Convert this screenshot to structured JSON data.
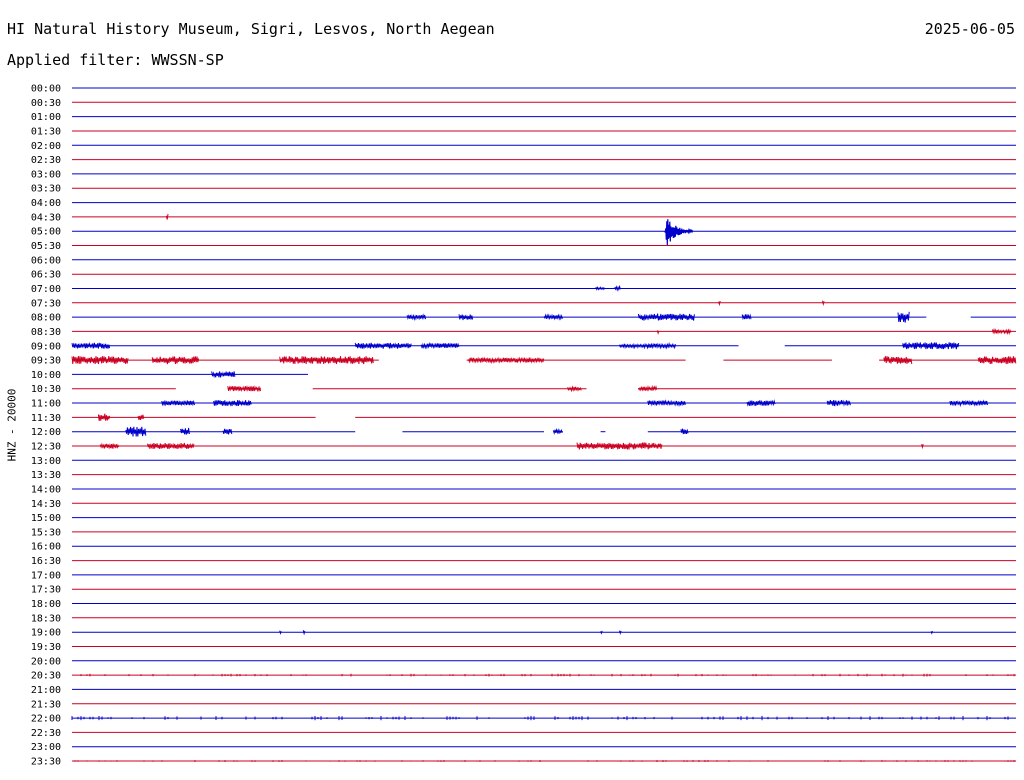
{
  "header": {
    "station": "HI Natural History Museum, Sigri, Lesvos, North Aegean",
    "date": "2025-06-05",
    "filter": "Applied filter: WWSSN-SP"
  },
  "chart_data": {
    "type": "line",
    "title": "HI Natural History Museum, Sigri, Lesvos, North Aegean",
    "subtitle": "Applied filter: WWSSN-SP",
    "ylabel": "HNZ - 20000",
    "xlabel": "",
    "colors": {
      "even_trace": "#0000cc",
      "odd_trace": "#cc0022"
    },
    "traces": [
      {
        "label": "00:00",
        "bursts": []
      },
      {
        "label": "00:30",
        "bursts": []
      },
      {
        "label": "01:00",
        "bursts": []
      },
      {
        "label": "01:30",
        "bursts": []
      },
      {
        "label": "02:00",
        "bursts": []
      },
      {
        "label": "02:30",
        "bursts": []
      },
      {
        "label": "03:00",
        "bursts": []
      },
      {
        "label": "03:30",
        "bursts": []
      },
      {
        "label": "04:00",
        "bursts": []
      },
      {
        "label": "04:30",
        "bursts": [
          {
            "t": 0.1,
            "w": 0.002,
            "a": 0.3
          }
        ]
      },
      {
        "label": "05:00",
        "bursts": [
          {
            "t": 0.628,
            "w": 0.03,
            "a": 1.0,
            "event": true
          }
        ]
      },
      {
        "label": "05:30",
        "bursts": []
      },
      {
        "label": "06:00",
        "bursts": []
      },
      {
        "label": "06:30",
        "bursts": []
      },
      {
        "label": "07:00",
        "bursts": [
          {
            "t": 0.555,
            "w": 0.01,
            "a": 0.15
          },
          {
            "t": 0.575,
            "w": 0.006,
            "a": 0.2
          }
        ]
      },
      {
        "label": "07:30",
        "bursts": [
          {
            "t": 0.685,
            "w": 0.002,
            "a": 0.2
          },
          {
            "t": 0.795,
            "w": 0.002,
            "a": 0.2
          }
        ]
      },
      {
        "label": "08:00",
        "bursts": [
          {
            "t": 0.355,
            "w": 0.02,
            "a": 0.25
          },
          {
            "t": 0.41,
            "w": 0.015,
            "a": 0.3
          },
          {
            "t": 0.5,
            "w": 0.02,
            "a": 0.2
          },
          {
            "t": 0.6,
            "w": 0.06,
            "a": 0.35
          },
          {
            "t": 0.71,
            "w": 0.01,
            "a": 0.3
          },
          {
            "t": 0.875,
            "w": 0.012,
            "a": 0.6
          }
        ],
        "gaps": [
          [
            0.905,
            0.952
          ]
        ]
      },
      {
        "label": "08:30",
        "bursts": [
          {
            "t": 0.62,
            "w": 0.002,
            "a": 0.2
          },
          {
            "t": 0.975,
            "w": 0.02,
            "a": 0.2
          }
        ]
      },
      {
        "label": "09:00",
        "bursts": [
          {
            "t": 0.0,
            "w": 0.04,
            "a": 0.3
          },
          {
            "t": 0.3,
            "w": 0.06,
            "a": 0.3
          },
          {
            "t": 0.37,
            "w": 0.04,
            "a": 0.25
          },
          {
            "t": 0.58,
            "w": 0.06,
            "a": 0.2
          },
          {
            "t": 0.88,
            "w": 0.06,
            "a": 0.35
          }
        ],
        "gaps": [
          [
            0.706,
            0.755
          ]
        ]
      },
      {
        "label": "09:30",
        "bursts": [
          {
            "t": 0.0,
            "w": 0.06,
            "a": 0.4
          },
          {
            "t": 0.085,
            "w": 0.05,
            "a": 0.4
          },
          {
            "t": 0.22,
            "w": 0.1,
            "a": 0.4
          },
          {
            "t": 0.42,
            "w": 0.08,
            "a": 0.25
          },
          {
            "t": 0.86,
            "w": 0.03,
            "a": 0.4
          },
          {
            "t": 0.96,
            "w": 0.04,
            "a": 0.4
          }
        ],
        "gaps": [
          [
            0.325,
            0.418
          ],
          [
            0.65,
            0.69
          ],
          [
            0.805,
            0.855
          ]
        ]
      },
      {
        "label": "10:00",
        "bursts": [
          {
            "t": 0.148,
            "w": 0.025,
            "a": 0.3
          }
        ],
        "gaps": [
          [
            0.25,
            1.0
          ]
        ]
      },
      {
        "label": "10:30",
        "bursts": [
          {
            "t": 0.165,
            "w": 0.035,
            "a": 0.25
          },
          {
            "t": 0.525,
            "w": 0.015,
            "a": 0.2
          },
          {
            "t": 0.6,
            "w": 0.02,
            "a": 0.2
          }
        ],
        "gaps": [
          [
            0.11,
            0.165
          ],
          [
            0.2,
            0.255
          ],
          [
            0.545,
            0.6
          ]
        ]
      },
      {
        "label": "11:00",
        "bursts": [
          {
            "t": 0.095,
            "w": 0.035,
            "a": 0.25
          },
          {
            "t": 0.15,
            "w": 0.04,
            "a": 0.3
          },
          {
            "t": 0.61,
            "w": 0.04,
            "a": 0.25
          },
          {
            "t": 0.715,
            "w": 0.03,
            "a": 0.3
          },
          {
            "t": 0.8,
            "w": 0.025,
            "a": 0.3
          },
          {
            "t": 0.93,
            "w": 0.04,
            "a": 0.25
          }
        ]
      },
      {
        "label": "11:30",
        "bursts": [
          {
            "t": 0.028,
            "w": 0.012,
            "a": 0.4
          },
          {
            "t": 0.07,
            "w": 0.006,
            "a": 0.3
          }
        ],
        "gaps": [
          [
            0.258,
            0.3
          ]
        ]
      },
      {
        "label": "12:00",
        "bursts": [
          {
            "t": 0.057,
            "w": 0.022,
            "a": 0.5
          },
          {
            "t": 0.115,
            "w": 0.01,
            "a": 0.4
          },
          {
            "t": 0.16,
            "w": 0.01,
            "a": 0.3
          },
          {
            "t": 0.51,
            "w": 0.01,
            "a": 0.2
          },
          {
            "t": 0.645,
            "w": 0.008,
            "a": 0.3
          }
        ],
        "gaps": [
          [
            0.3,
            0.35
          ],
          [
            0.5,
            0.51
          ],
          [
            0.52,
            0.56
          ],
          [
            0.565,
            0.61
          ]
        ]
      },
      {
        "label": "12:30",
        "bursts": [
          {
            "t": 0.03,
            "w": 0.02,
            "a": 0.25
          },
          {
            "t": 0.08,
            "w": 0.05,
            "a": 0.3
          },
          {
            "t": 0.535,
            "w": 0.09,
            "a": 0.35
          },
          {
            "t": 0.9,
            "w": 0.002,
            "a": 0.2
          }
        ]
      },
      {
        "label": "13:00",
        "bursts": []
      },
      {
        "label": "13:30",
        "bursts": []
      },
      {
        "label": "14:00",
        "bursts": []
      },
      {
        "label": "14:30",
        "bursts": []
      },
      {
        "label": "15:00",
        "bursts": []
      },
      {
        "label": "15:30",
        "bursts": []
      },
      {
        "label": "16:00",
        "bursts": []
      },
      {
        "label": "16:30",
        "bursts": []
      },
      {
        "label": "17:00",
        "bursts": []
      },
      {
        "label": "17:30",
        "bursts": []
      },
      {
        "label": "18:00",
        "bursts": []
      },
      {
        "label": "18:30",
        "bursts": []
      },
      {
        "label": "19:00",
        "bursts": [
          {
            "t": 0.22,
            "w": 0.002,
            "a": 0.2
          },
          {
            "t": 0.245,
            "w": 0.002,
            "a": 0.2
          },
          {
            "t": 0.56,
            "w": 0.002,
            "a": 0.2
          },
          {
            "t": 0.58,
            "w": 0.002,
            "a": 0.2
          },
          {
            "t": 0.91,
            "w": 0.002,
            "a": 0.2
          }
        ]
      },
      {
        "label": "19:30",
        "bursts": []
      },
      {
        "label": "20:00",
        "bursts": []
      },
      {
        "label": "20:30",
        "bursts": [
          {
            "t": 0.0,
            "w": 1.0,
            "a": 0.12,
            "sparse": true
          }
        ]
      },
      {
        "label": "21:00",
        "bursts": []
      },
      {
        "label": "21:30",
        "bursts": []
      },
      {
        "label": "22:00",
        "bursts": [
          {
            "t": 0.0,
            "w": 1.0,
            "a": 0.18,
            "sparse": true
          }
        ]
      },
      {
        "label": "22:30",
        "bursts": []
      },
      {
        "label": "23:00",
        "bursts": []
      },
      {
        "label": "23:30",
        "bursts": [
          {
            "t": 0.0,
            "w": 1.0,
            "a": 0.08,
            "sparse": true
          }
        ]
      }
    ]
  }
}
